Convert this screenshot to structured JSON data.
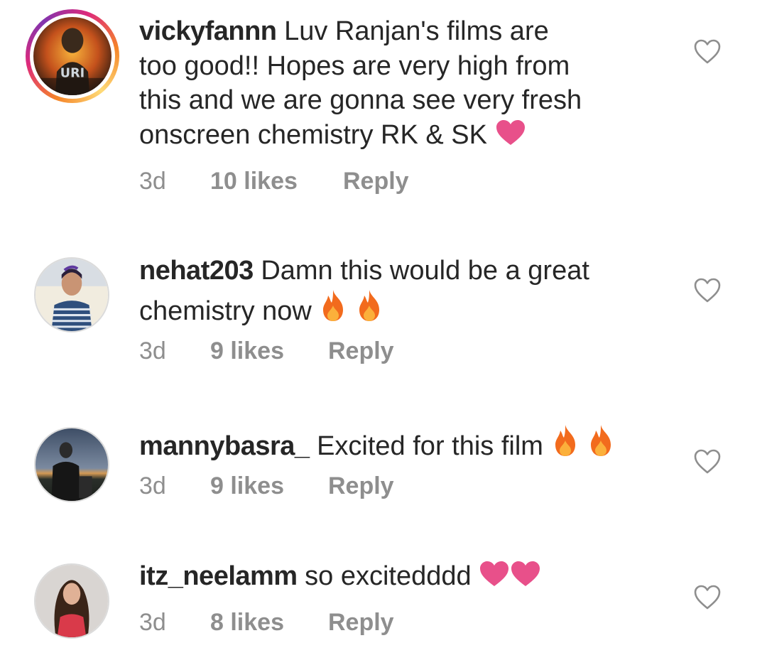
{
  "comments": [
    {
      "username": "vickyfannn",
      "text_lines": [
        "Luv Ranjan's films are",
        "too good!! Hopes are very high from",
        "this and we are gonna see very fresh",
        "onscreen chemistry RK & SK"
      ],
      "emoji": [
        "pink-heart"
      ],
      "time": "3d",
      "likes": "10 likes",
      "reply": "Reply",
      "avatar_text": "URI"
    },
    {
      "username": "nehat203",
      "text_lines": [
        "Damn this would be a great",
        "chemistry now"
      ],
      "emoji": [
        "fire",
        "fire"
      ],
      "time": "3d",
      "likes": "9 likes",
      "reply": "Reply"
    },
    {
      "username": "mannybasra_",
      "text_lines": [
        "Excited for this film"
      ],
      "emoji": [
        "fire",
        "fire"
      ],
      "time": "3d",
      "likes": "9 likes",
      "reply": "Reply"
    },
    {
      "username": "itz_neelamm",
      "text_lines": [
        "so excitedddd"
      ],
      "emoji": [
        "pink-heart",
        "pink-heart"
      ],
      "time": "3d",
      "likes": "8 likes",
      "reply": "Reply"
    }
  ],
  "colors": {
    "text": "#262626",
    "muted": "#8e8e8e",
    "heart_emoji": "#e8508a",
    "fire": "#f26b1d"
  }
}
